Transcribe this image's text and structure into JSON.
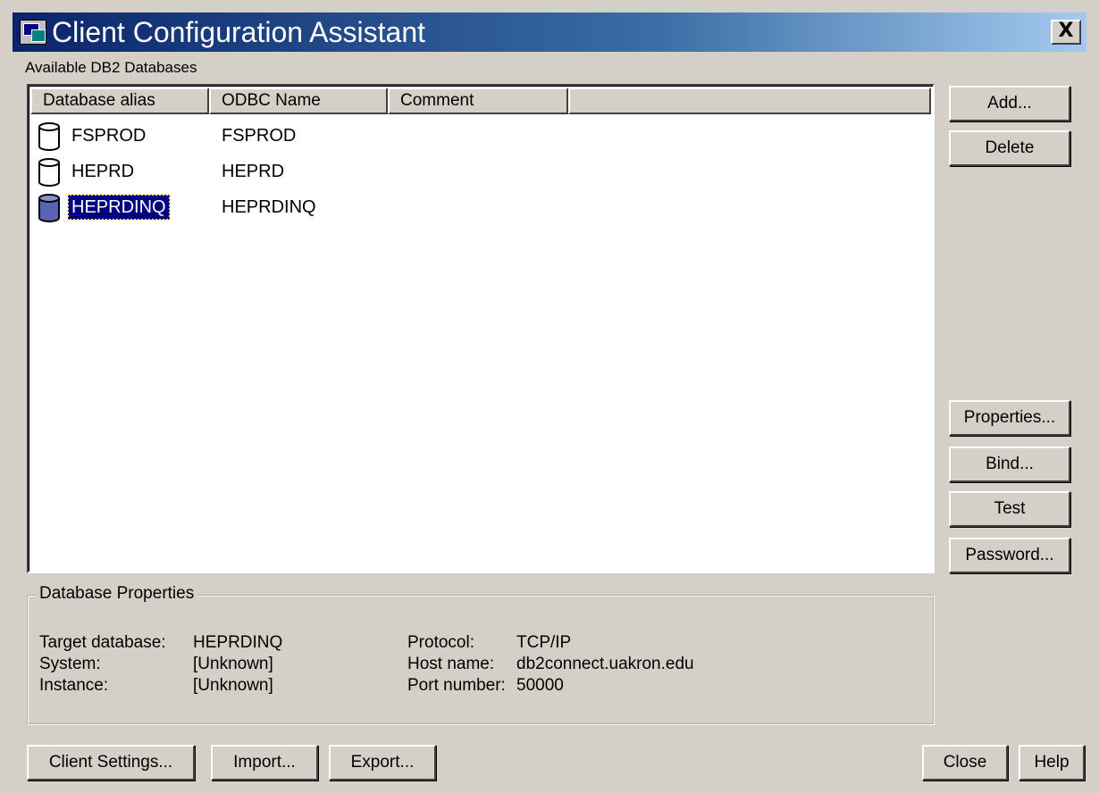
{
  "window": {
    "title": "Client Configuration Assistant",
    "close_glyph": "X"
  },
  "list": {
    "caption": "Available DB2 Databases",
    "columns": [
      "Database alias",
      "ODBC Name",
      "Comment"
    ],
    "rows": [
      {
        "alias": "FSPROD",
        "odbc": "FSPROD",
        "comment": "",
        "icon": "database-icon",
        "selected": false
      },
      {
        "alias": "HEPRD",
        "odbc": "HEPRD",
        "comment": "",
        "icon": "database-icon",
        "selected": false
      },
      {
        "alias": "HEPRDINQ",
        "odbc": "HEPRDINQ",
        "comment": "",
        "icon": "database-icon",
        "selected": true
      }
    ]
  },
  "side_buttons": {
    "add": "Add...",
    "delete": "Delete",
    "properties": "Properties...",
    "bind": "Bind...",
    "test": "Test",
    "password": "Password..."
  },
  "properties": {
    "legend": "Database Properties",
    "target_label": "Target database:",
    "target_value": "HEPRDINQ",
    "system_label": "System:",
    "system_value": "[Unknown]",
    "instance_label": "Instance:",
    "instance_value": "[Unknown]",
    "protocol_label": "Protocol:",
    "protocol_value": "TCP/IP",
    "host_label": "Host name:",
    "host_value": "db2connect.uakron.edu",
    "port_label": "Port number:",
    "port_value": "50000"
  },
  "bottom_buttons": {
    "client_settings": "Client Settings...",
    "import": "Import...",
    "export": "Export...",
    "close": "Close",
    "help": "Help"
  },
  "colors": {
    "title_start": "#0a246a",
    "title_end": "#a6caf0",
    "selection": "#000080",
    "face": "#d4d0c8"
  }
}
